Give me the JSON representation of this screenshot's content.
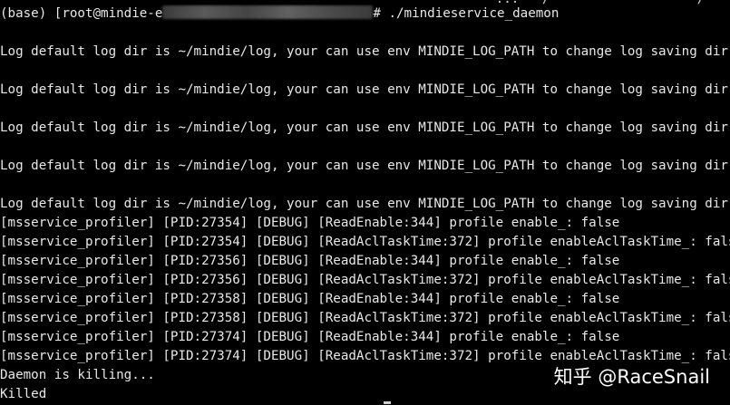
{
  "terminal": {
    "top_fragment": "                                                                ...   /                   /     /",
    "prompt_prefix": "(base) [root@mindie-e",
    "prompt_suffix": "# ./mindieservice_daemon",
    "lines": [
      "",
      "Log default log dir is ~/mindie/log, your can use env MINDIE_LOG_PATH to change log saving dir.",
      "",
      "Log default log dir is ~/mindie/log, your can use env MINDIE_LOG_PATH to change log saving dir.",
      "",
      "Log default log dir is ~/mindie/log, your can use env MINDIE_LOG_PATH to change log saving dir.",
      "",
      "Log default log dir is ~/mindie/log, your can use env MINDIE_LOG_PATH to change log saving dir.",
      "",
      "Log default log dir is ~/mindie/log, your can use env MINDIE_LOG_PATH to change log saving dir.",
      "[msservice_profiler] [PID:27354] [DEBUG] [ReadEnable:344] profile enable_: false",
      "[msservice_profiler] [PID:27354] [DEBUG] [ReadAclTaskTime:372] profile enableAclTaskTime_: false",
      "[msservice_profiler] [PID:27356] [DEBUG] [ReadEnable:344] profile enable_: false",
      "[msservice_profiler] [PID:27356] [DEBUG] [ReadAclTaskTime:372] profile enableAclTaskTime_: false",
      "[msservice_profiler] [PID:27358] [DEBUG] [ReadEnable:344] profile enable_: false",
      "[msservice_profiler] [PID:27358] [DEBUG] [ReadAclTaskTime:372] profile enableAclTaskTime_: false",
      "[msservice_profiler] [PID:27374] [DEBUG] [ReadEnable:344] profile enable_: false",
      "[msservice_profiler] [PID:27374] [DEBUG] [ReadAclTaskTime:372] profile enableAclTaskTime_: false",
      "Daemon is killing...",
      "Killed"
    ]
  },
  "watermark": {
    "text": "知乎 @RaceSnail"
  }
}
